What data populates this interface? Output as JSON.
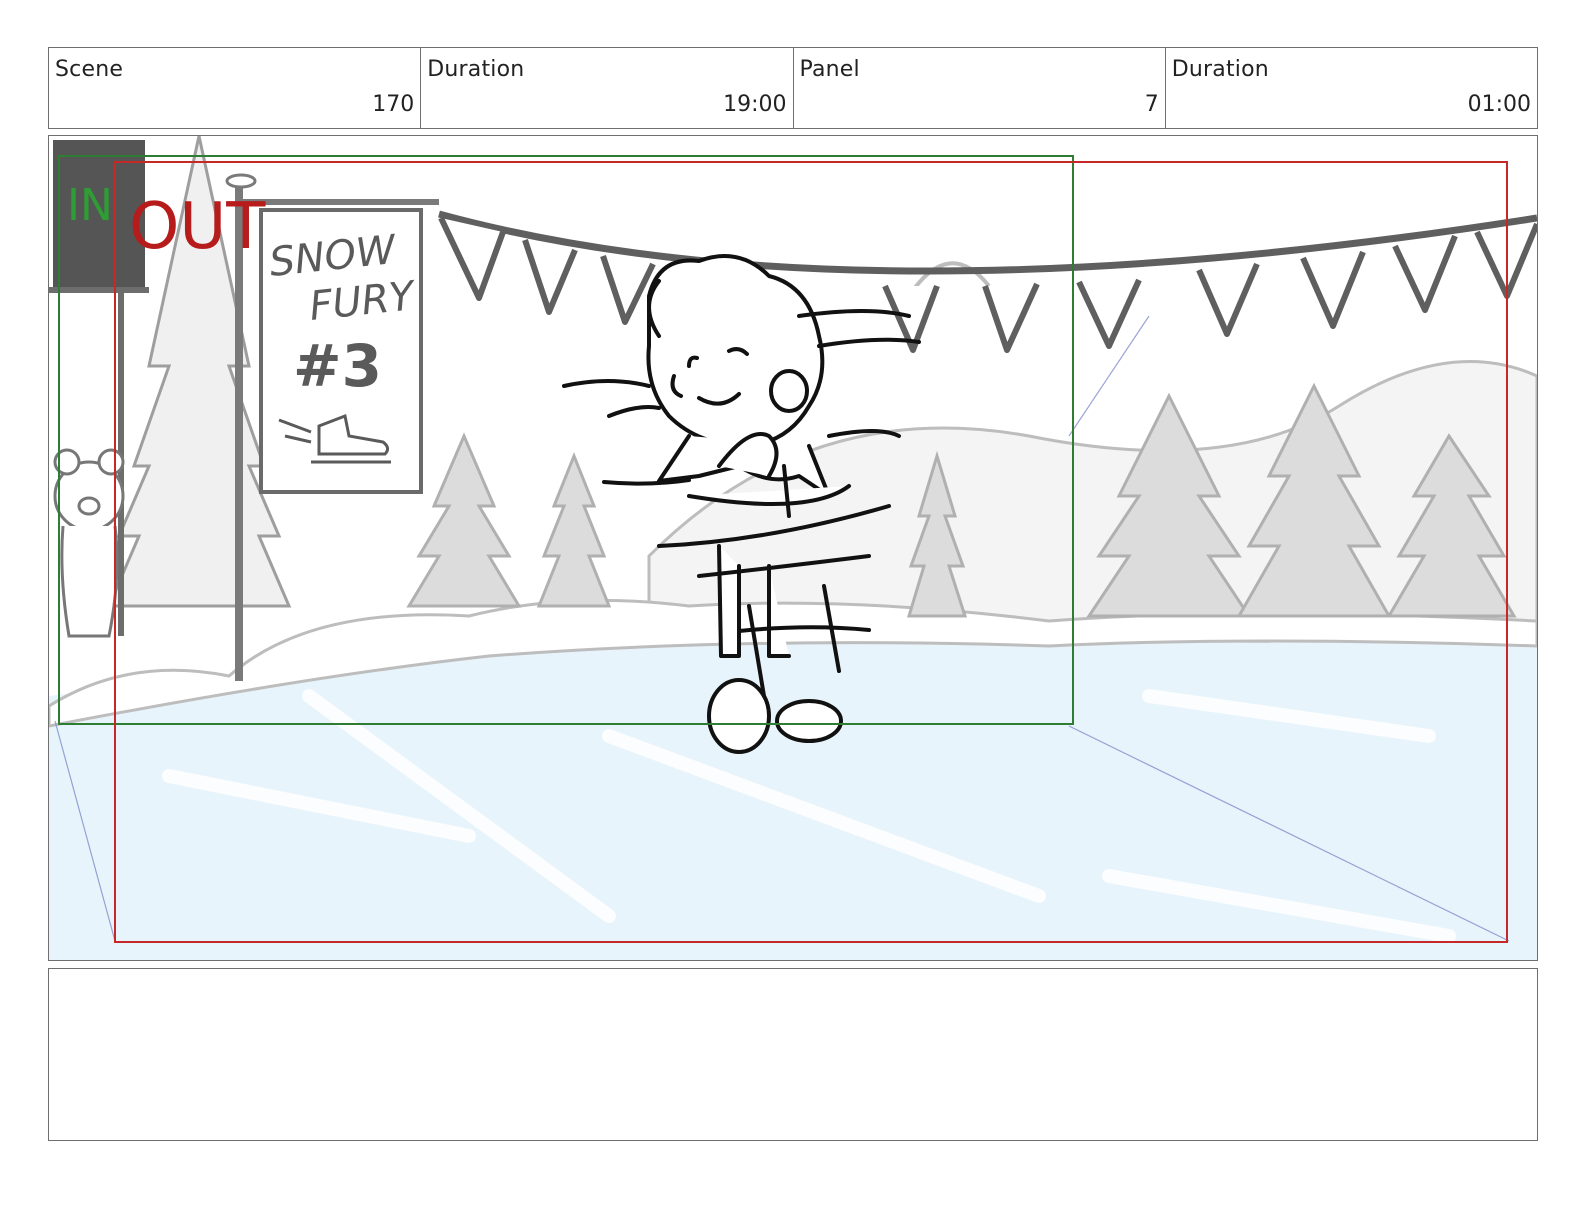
{
  "header": {
    "scene_label": "Scene",
    "scene_value": "170",
    "scene_duration_label": "Duration",
    "scene_duration_value": "19:00",
    "panel_label": "Panel",
    "panel_value": "7",
    "panel_duration_label": "Duration",
    "panel_duration_value": "01:00"
  },
  "panel": {
    "in_marker": "IN",
    "out_marker": "OUT",
    "sign_line1": "SNOW",
    "sign_line2": "FURY",
    "sign_line3": "#3"
  },
  "colors": {
    "in_frame": "#2e7d32",
    "out_frame": "#c62828",
    "sketch_light": "#b5b5b5",
    "sketch_dark": "#555555",
    "ice": "#e8f4fb"
  },
  "notes": ""
}
